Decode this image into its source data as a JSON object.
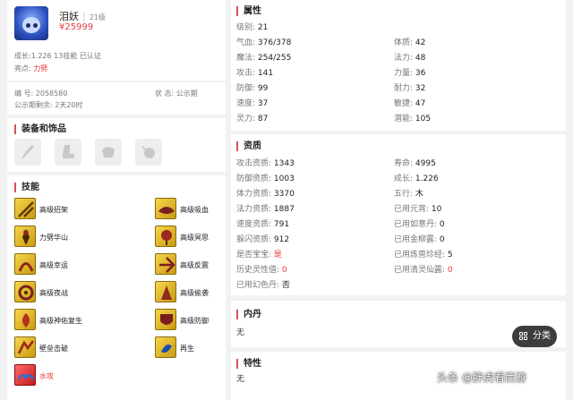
{
  "pet": {
    "name": "泪妖",
    "level": "21级",
    "price": "¥25999",
    "growth_line": "成长:1.226 13技能 已认证",
    "highlight_label": "亮点:",
    "highlight_value": "力劈",
    "id_line": "编 号: 2058580",
    "status_line": "状 态: 公示期",
    "publicity_line": "公示期剩余: 2天20时"
  },
  "equipment": {
    "title": "装备和饰品",
    "slots": [
      "claw-icon",
      "boot-icon",
      "armor-icon",
      "bell-icon"
    ]
  },
  "skills": {
    "title": "技能",
    "items": [
      {
        "label": "高级招架",
        "icon": "parry-icon"
      },
      {
        "label": "高级吸血",
        "icon": "bloodsuck-icon"
      },
      {
        "label": "力劈华山",
        "icon": "lipi-icon"
      },
      {
        "label": "高级冥思",
        "icon": "meditation-icon"
      },
      {
        "label": "高级幸运",
        "icon": "luck-icon"
      },
      {
        "label": "高级反震",
        "icon": "counter-icon"
      },
      {
        "label": "高级夜战",
        "icon": "nightfight-icon"
      },
      {
        "label": "高级偷袭",
        "icon": "sneak-icon"
      },
      {
        "label": "高级神佑复生",
        "icon": "revive-icon"
      },
      {
        "label": "高级防御",
        "icon": "defense-icon"
      },
      {
        "label": "壁垒击破",
        "icon": "breakwall-icon"
      },
      {
        "label": "再生",
        "icon": "regen-icon"
      },
      {
        "label": "水攻",
        "icon": "water-icon"
      }
    ]
  },
  "attributes": {
    "title": "属性",
    "level": {
      "k": "级别:",
      "v": "21"
    },
    "left": [
      {
        "k": "气血:",
        "v": "376/378"
      },
      {
        "k": "魔法:",
        "v": "254/255"
      },
      {
        "k": "攻击:",
        "v": "141"
      },
      {
        "k": "防御:",
        "v": "99"
      },
      {
        "k": "速度:",
        "v": "37"
      },
      {
        "k": "灵力:",
        "v": "87"
      }
    ],
    "right": [
      {
        "k": "体质:",
        "v": "42"
      },
      {
        "k": "法力:",
        "v": "48"
      },
      {
        "k": "力量:",
        "v": "36"
      },
      {
        "k": "耐力:",
        "v": "32"
      },
      {
        "k": "敏捷:",
        "v": "47"
      },
      {
        "k": "潜能:",
        "v": "105"
      }
    ]
  },
  "aptitude": {
    "title": "资质",
    "left": [
      {
        "k": "攻击资质:",
        "v": "1343"
      },
      {
        "k": "防御资质:",
        "v": "1003"
      },
      {
        "k": "体力资质:",
        "v": "3370"
      },
      {
        "k": "法力资质:",
        "v": "1887"
      },
      {
        "k": "速度资质:",
        "v": "791"
      },
      {
        "k": "躲闪资质:",
        "v": "912"
      },
      {
        "k": "是否宝宝:",
        "v": "是"
      },
      {
        "k": "历史灵性值:",
        "v": "0"
      },
      {
        "k": "已用幻色丹:",
        "v": "否"
      }
    ],
    "right": [
      {
        "k": "寿命:",
        "v": "4995"
      },
      {
        "k": "成长:",
        "v": "1.226"
      },
      {
        "k": "五行:",
        "v": "木"
      },
      {
        "k": "已用元宵:",
        "v": "10"
      },
      {
        "k": "已用如意丹:",
        "v": "0"
      },
      {
        "k": "已用金柳露:",
        "v": "0"
      },
      {
        "k": "已用炼兽珍经:",
        "v": "5"
      },
      {
        "k": "已用清灵仙露:",
        "v": "0"
      }
    ]
  },
  "neidan": {
    "title": "内丹",
    "value": "无"
  },
  "traits": {
    "title": "特性",
    "value": "无"
  },
  "category_button": "分类",
  "watermark": "头条 @胖虎看西游",
  "colors": {
    "accent": "#e4393c",
    "section_bar": "#d9534f",
    "skill_gold": "#f6d64a"
  }
}
